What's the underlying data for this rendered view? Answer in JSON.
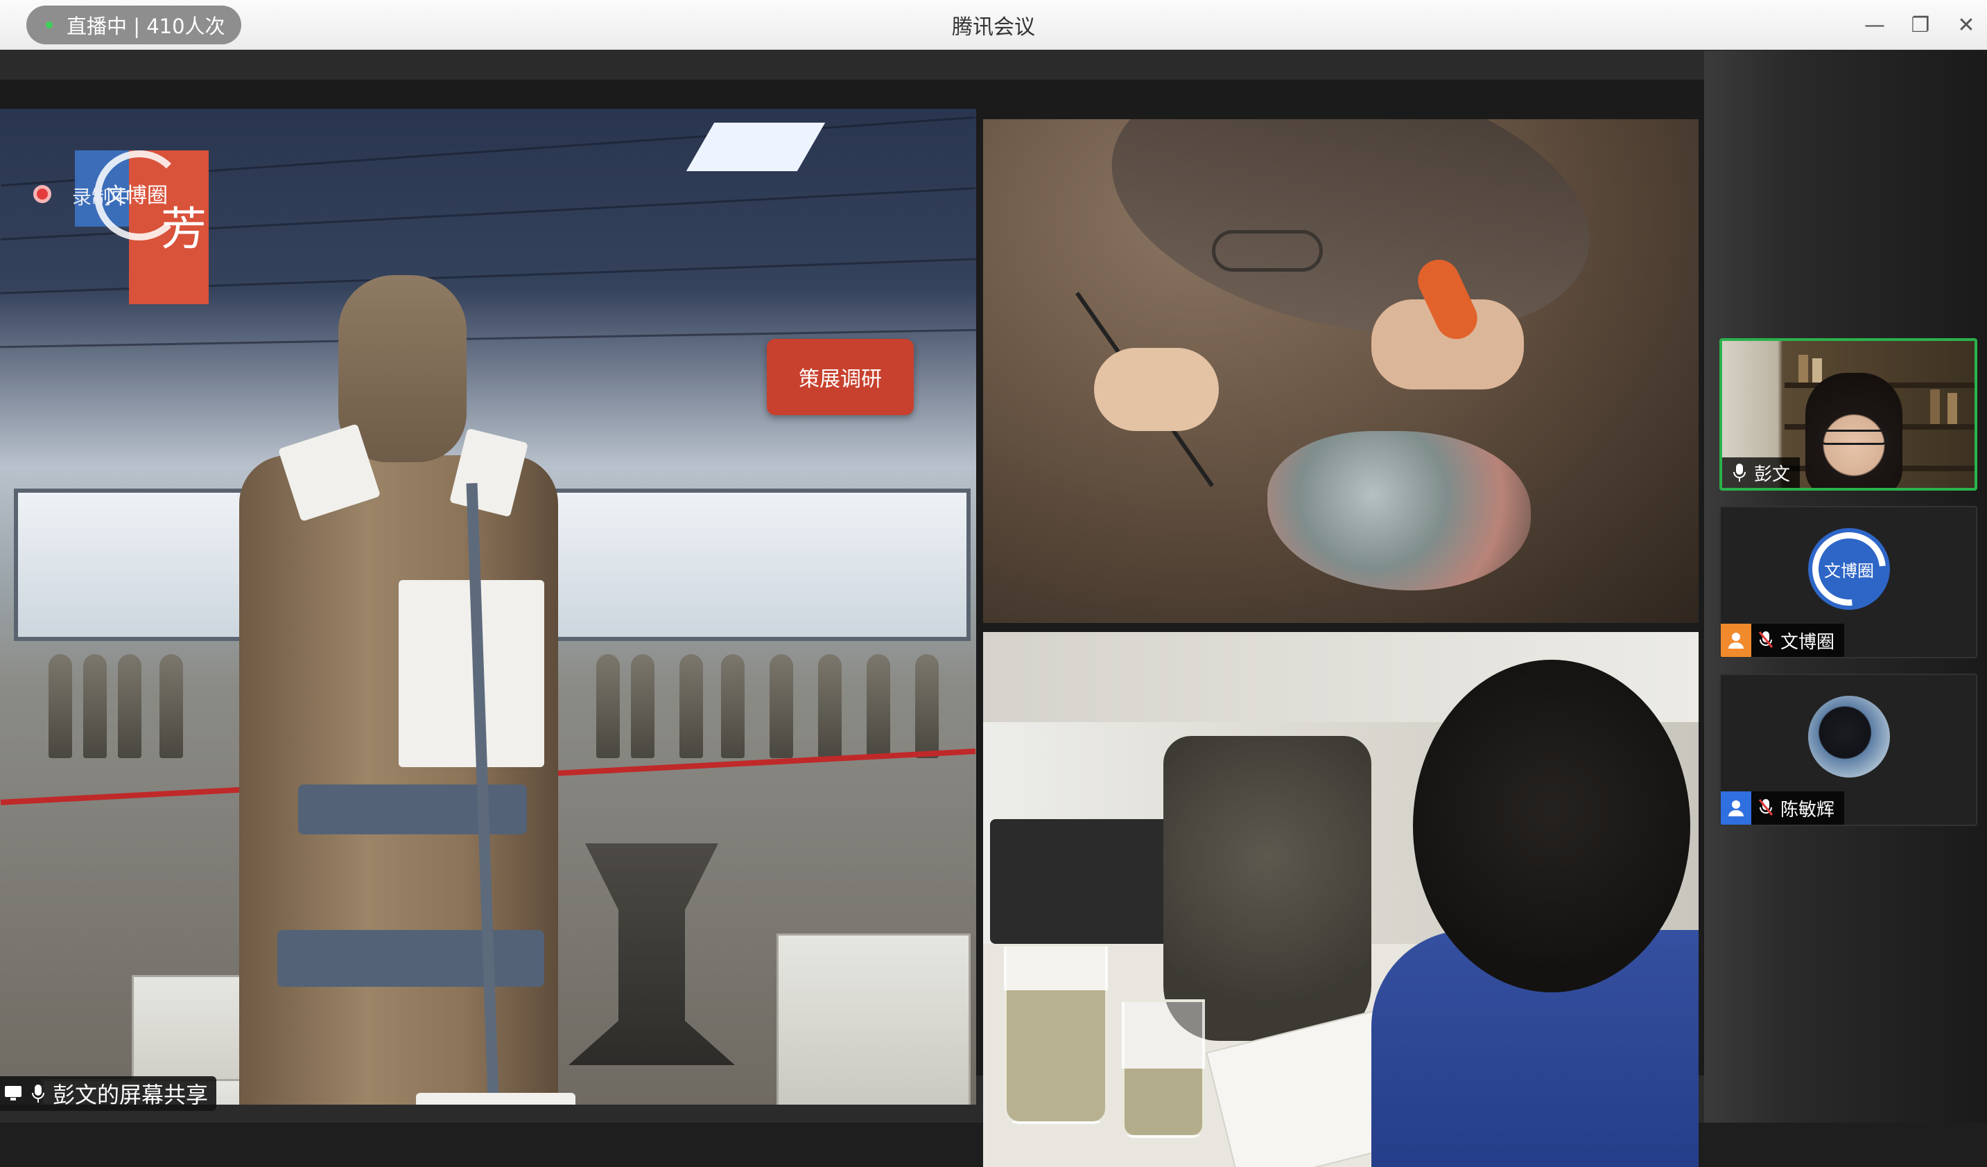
{
  "window": {
    "title": "腾讯会议",
    "live_status": "直播中 | 410人次",
    "controls": {
      "minimize": "—",
      "restore": "❐",
      "close": "✕"
    }
  },
  "screen_share": {
    "sharer_label": "彭文的屏幕共享",
    "slide": {
      "logo_text": "文博圈",
      "logo_char": "芳",
      "recording_label": "录制中",
      "tag_button": "策展调研"
    }
  },
  "participants": [
    {
      "name": "彭文",
      "role_icon": "camera-on",
      "active_speaker": true
    },
    {
      "name": "文博圈",
      "role_icon": "host-user-icon",
      "avatar_text": "文博圈"
    },
    {
      "name": "陈敏辉",
      "role_icon": "cohost-user-icon"
    }
  ],
  "colors": {
    "live_pill": "#8e8e8e",
    "active_border": "#2bb24c",
    "tag_button": "#c8412e",
    "host_badge": "#f08a2c",
    "cohost_badge": "#2f6fe0"
  }
}
